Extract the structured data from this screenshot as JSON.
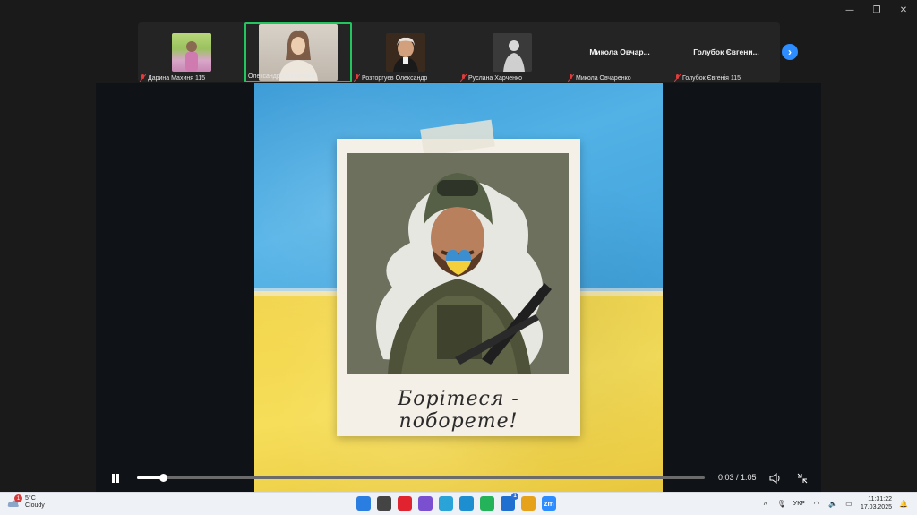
{
  "window": {
    "minimize_glyph": "—",
    "restore_glyph": "❐",
    "close_glyph": "✕"
  },
  "participants": [
    {
      "name": "Дарина Махиня 115",
      "muted": true,
      "has_video": true
    },
    {
      "name": "Олександра Погребняк",
      "muted": false,
      "has_video": true,
      "active": true
    },
    {
      "name": "Розторгуєв Олександр",
      "muted": true,
      "has_video": true
    },
    {
      "name": "Руслана Харченко",
      "muted": true,
      "has_video": true
    },
    {
      "name": "Микола Овчаренко",
      "display_name": "Микола  Овчар...",
      "muted": true,
      "has_video": false
    },
    {
      "name": "Голубок Євгенія 115",
      "display_name": "Голубок  Євгени...",
      "muted": true,
      "has_video": false
    }
  ],
  "video": {
    "caption": "Борітеся - поборете!",
    "time_label": "0:03 / 1:05",
    "progress": 0.046
  },
  "taskbar": {
    "weather_temp": "5°C",
    "weather_desc": "Cloudy",
    "weather_badge": "1",
    "language": "УКР",
    "time": "11:31:22",
    "date": "17.03.2025",
    "apps": [
      {
        "name": "windows-start",
        "color": "#2a7de1"
      },
      {
        "name": "file-explorer",
        "color": "#444"
      },
      {
        "name": "opera",
        "color": "#e0232e"
      },
      {
        "name": "viber",
        "color": "#7a4fd0"
      },
      {
        "name": "telegram-store",
        "color": "#2aa3d8"
      },
      {
        "name": "edge",
        "color": "#1d8fd1"
      },
      {
        "name": "whatsapp",
        "color": "#25b35a"
      },
      {
        "name": "outlook",
        "color": "#1f6fd0",
        "badge": "1"
      },
      {
        "name": "maps",
        "color": "#e6a21b"
      },
      {
        "name": "zoom",
        "color": "#2d8cff",
        "label": "zm"
      }
    ]
  }
}
